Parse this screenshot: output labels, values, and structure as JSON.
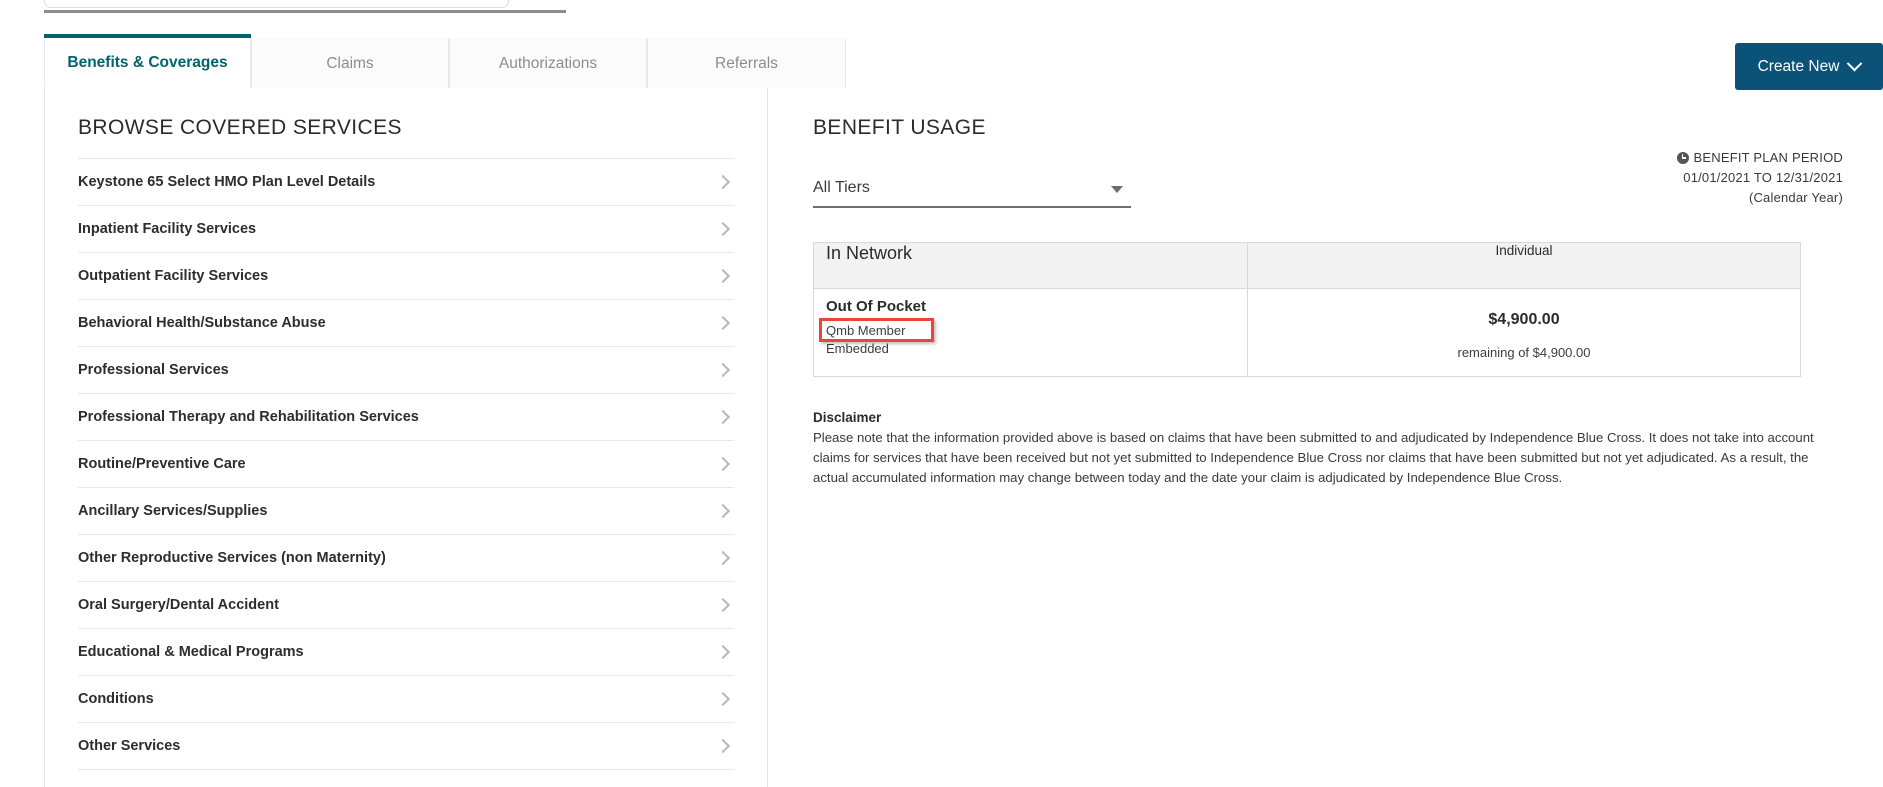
{
  "tabs": [
    {
      "label": "Benefits & Coverages",
      "active": true
    },
    {
      "label": "Claims",
      "active": false
    },
    {
      "label": "Authorizations",
      "active": false
    },
    {
      "label": "Referrals",
      "active": false
    }
  ],
  "toolbar": {
    "create_new_label": "Create New"
  },
  "left_panel": {
    "title": "BROWSE COVERED SERVICES",
    "items": [
      {
        "label": "Keystone 65 Select HMO Plan Level Details"
      },
      {
        "label": "Inpatient Facility Services"
      },
      {
        "label": "Outpatient Facility Services"
      },
      {
        "label": "Behavioral Health/Substance Abuse"
      },
      {
        "label": "Professional Services"
      },
      {
        "label": "Professional Therapy and Rehabilitation Services"
      },
      {
        "label": "Routine/Preventive Care"
      },
      {
        "label": "Ancillary Services/Supplies"
      },
      {
        "label": "Other Reproductive Services (non Maternity)"
      },
      {
        "label": "Oral Surgery/Dental Accident"
      },
      {
        "label": "Educational & Medical Programs"
      },
      {
        "label": "Conditions"
      },
      {
        "label": "Other Services"
      }
    ]
  },
  "right_panel": {
    "title": "BENEFIT USAGE",
    "tier_select": {
      "value": "All Tiers",
      "placeholder": "All Tiers"
    },
    "plan_period": {
      "heading": "BENEFIT PLAN PERIOD",
      "range": "01/01/2021 TO 12/31/2021",
      "note": "(Calendar Year)"
    },
    "table": {
      "headers": [
        "In Network",
        "Individual"
      ],
      "rows": [
        {
          "category": "Out Of Pocket",
          "sub1": "Qmb Member",
          "sub2": "Embedded",
          "amount": "$4,900.00",
          "remaining": "remaining of $4,900.00",
          "highlighted": true
        }
      ]
    },
    "disclaimer": {
      "title": "Disclaimer",
      "body": "Please note that the information provided above is based on claims that have been submitted to and adjudicated by Independence Blue Cross. It does not take into account claims for services that have been received but not yet submitted to Independence Blue Cross nor claims that have been submitted but not yet adjudicated. As a result, the actual accumulated information may change between today and the date your claim is adjudicated by Independence Blue Cross."
    }
  },
  "colors": {
    "accent_teal": "#00646e",
    "button_navy": "#0a5278",
    "highlight_red": "#e8453c",
    "table_header_gray": "#f2f2f2"
  }
}
